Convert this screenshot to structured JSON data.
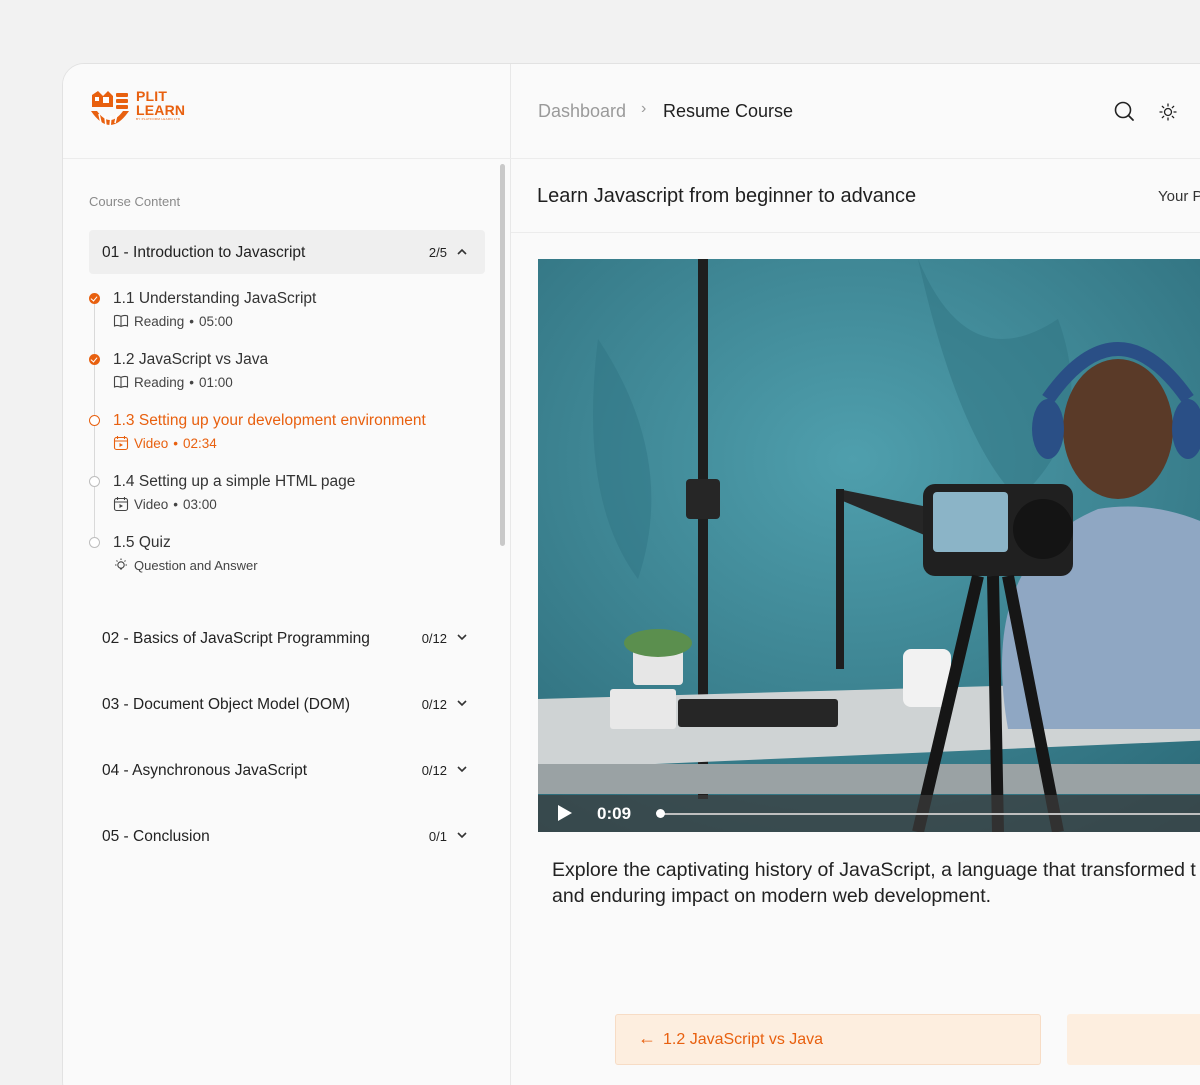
{
  "brand": {
    "name_line1": "PLIT",
    "name_line2": "LEARN",
    "tagline": "BY PLATFORM LEARN LTD"
  },
  "breadcrumb": {
    "root": "Dashboard",
    "separator": "›",
    "current": "Resume Course"
  },
  "header_icons": [
    "search-icon",
    "sun-icon"
  ],
  "sidebar": {
    "section_label": "Course Content",
    "open_module": {
      "title": "01 - Introduction to Javascript",
      "count": "2/5"
    },
    "lessons": [
      {
        "title": "1.1 Understanding JavaScript",
        "type": "Reading",
        "duration": "05:00",
        "status": "done"
      },
      {
        "title": "1.2 JavaScript vs Java",
        "type": "Reading",
        "duration": "01:00",
        "status": "done"
      },
      {
        "title": "1.3 Setting up your development environment",
        "type": "Video",
        "duration": "02:34",
        "status": "current"
      },
      {
        "title": "1.4 Setting up a simple HTML page",
        "type": "Video",
        "duration": "03:00",
        "status": "pending"
      },
      {
        "title": "1.5 Quiz",
        "type": "Question and Answer",
        "duration": "",
        "status": "pending"
      }
    ],
    "modules": [
      {
        "title": "02 - Basics of JavaScript Programming",
        "count": "0/12"
      },
      {
        "title": "03 - Document Object Model (DOM)",
        "count": "0/12"
      },
      {
        "title": "04 - Asynchronous JavaScript",
        "count": "0/12"
      },
      {
        "title": "05 - Conclusion",
        "count": "0/1"
      }
    ]
  },
  "course": {
    "title": "Learn Javascript from beginner to advance",
    "progress_label": "Your P"
  },
  "video": {
    "time": "0:09"
  },
  "description": {
    "line1": "Explore the captivating history of JavaScript, a language that transformed t",
    "line2": "and enduring impact on modern web development."
  },
  "navigation": {
    "prev_label": "1.2 JavaScript vs Java",
    "prev_arrow": "←"
  },
  "colors": {
    "accent": "#e8600f",
    "accent_soft": "#fdeedf"
  }
}
